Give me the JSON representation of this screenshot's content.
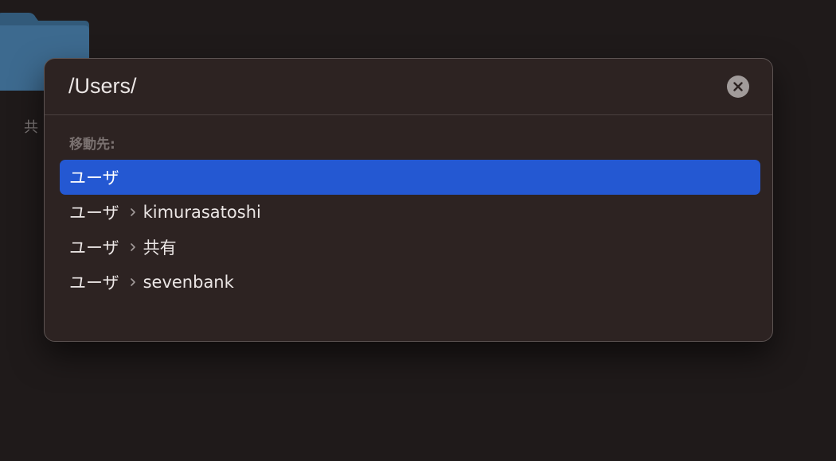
{
  "background": {
    "folder_label": "共"
  },
  "dialog": {
    "path_value": "/Users/",
    "section_label": "移動先:",
    "results": [
      {
        "parent": "ユーザ",
        "child": ""
      },
      {
        "parent": "ユーザ",
        "child": "kimurasatoshi"
      },
      {
        "parent": "ユーザ",
        "child": "共有"
      },
      {
        "parent": "ユーザ",
        "child": "sevenbank"
      }
    ],
    "selected_index": 0
  },
  "colors": {
    "selection": "#2458d2",
    "dialog_bg": "#2d2322",
    "folder": "#3d6a8f"
  },
  "icons": {
    "clear": "xmark-circle-icon",
    "separator": "chevron-right-icon",
    "folder": "folder-icon"
  }
}
